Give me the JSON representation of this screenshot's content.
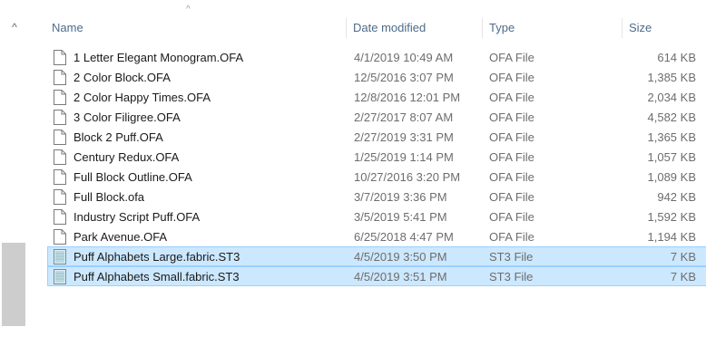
{
  "columns": {
    "name": "Name",
    "date": "Date modified",
    "type": "Type",
    "size": "Size"
  },
  "sort_indicator": "^",
  "scroll_up": "^",
  "files": [
    {
      "name": "1 Letter Elegant Monogram.OFA",
      "date": "4/1/2019 10:49 AM",
      "type": "OFA File",
      "size": "614 KB",
      "icon": "document-icon",
      "selected": false
    },
    {
      "name": "2 Color Block.OFA",
      "date": "12/5/2016 3:07 PM",
      "type": "OFA File",
      "size": "1,385 KB",
      "icon": "document-icon",
      "selected": false
    },
    {
      "name": "2 Color Happy Times.OFA",
      "date": "12/8/2016 12:01 PM",
      "type": "OFA File",
      "size": "2,034 KB",
      "icon": "document-icon",
      "selected": false
    },
    {
      "name": "3 Color Filigree.OFA",
      "date": "2/27/2017 8:07 AM",
      "type": "OFA File",
      "size": "4,582 KB",
      "icon": "document-icon",
      "selected": false
    },
    {
      "name": "Block 2 Puff.OFA",
      "date": "2/27/2019 3:31 PM",
      "type": "OFA File",
      "size": "1,365 KB",
      "icon": "document-icon",
      "selected": false
    },
    {
      "name": "Century Redux.OFA",
      "date": "1/25/2019 1:14 PM",
      "type": "OFA File",
      "size": "1,057 KB",
      "icon": "document-icon",
      "selected": false
    },
    {
      "name": "Full Block Outline.OFA",
      "date": "10/27/2016 3:20 PM",
      "type": "OFA File",
      "size": "1,089 KB",
      "icon": "document-icon",
      "selected": false
    },
    {
      "name": "Full Block.ofa",
      "date": "3/7/2019 3:36 PM",
      "type": "OFA File",
      "size": "942 KB",
      "icon": "document-icon",
      "selected": false
    },
    {
      "name": "Industry Script Puff.OFA",
      "date": "3/5/2019 5:41 PM",
      "type": "OFA File",
      "size": "1,592 KB",
      "icon": "document-icon",
      "selected": false
    },
    {
      "name": "Park Avenue.OFA",
      "date": "6/25/2018 4:47 PM",
      "type": "OFA File",
      "size": "1,194 KB",
      "icon": "document-icon",
      "selected": false
    },
    {
      "name": "Puff Alphabets Large.fabric.ST3",
      "date": "4/5/2019 3:50 PM",
      "type": "ST3 File",
      "size": "7 KB",
      "icon": "fabric-file-icon",
      "selected": true
    },
    {
      "name": "Puff Alphabets Small.fabric.ST3",
      "date": "4/5/2019 3:51 PM",
      "type": "ST3 File",
      "size": "7 KB",
      "icon": "fabric-file-icon",
      "selected": true
    }
  ],
  "colors": {
    "header_text": "#4d6b8a",
    "selection_bg": "#cce8ff",
    "selection_border": "#99d1ff"
  }
}
